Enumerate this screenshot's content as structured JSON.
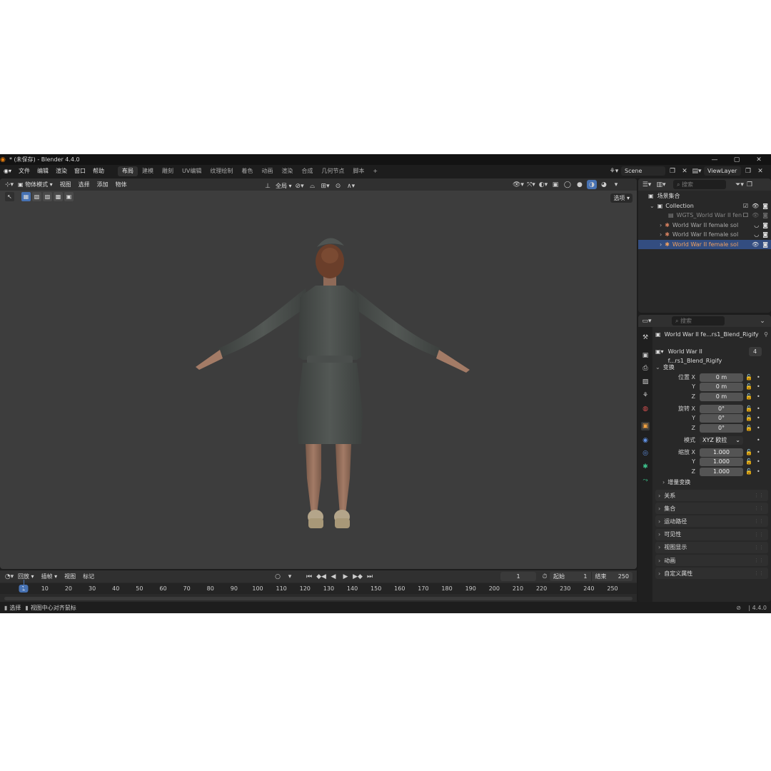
{
  "titlebar": {
    "title": "* (未保存) - Blender 4.4.0"
  },
  "menubar": {
    "items": [
      "文件",
      "编辑",
      "渲染",
      "窗口",
      "帮助"
    ],
    "workspaces": [
      "布局",
      "建模",
      "雕刻",
      "UV编辑",
      "纹理绘制",
      "着色",
      "动画",
      "渲染",
      "合成",
      "几何节点",
      "脚本"
    ],
    "active_workspace": "布局",
    "add_tab": "+",
    "scene": "Scene",
    "view_layer": "ViewLayer"
  },
  "viewport": {
    "mode": "物体模式",
    "menus": [
      "视图",
      "选择",
      "添加",
      "物体"
    ],
    "orientation": "全局",
    "options": "选项"
  },
  "timeline": {
    "playback": "回放",
    "keying": "插帧",
    "view": "视图",
    "marker": "标记",
    "current_frame": "1",
    "start_label": "起始",
    "start": "1",
    "end_label": "结束",
    "end": "250",
    "ticks": [
      1,
      10,
      20,
      30,
      40,
      50,
      60,
      70,
      80,
      90,
      100,
      110,
      120,
      130,
      140,
      150,
      160,
      170,
      180,
      190,
      200,
      210,
      220,
      230,
      240,
      250
    ]
  },
  "status": {
    "select": "选择",
    "center": "视图中心对齐鼠标",
    "version": "4.4.0"
  },
  "outliner": {
    "search_placeholder": "搜索",
    "root": "场景集合",
    "collection": "Collection",
    "items": [
      {
        "name": "WGTS_World War II fen",
        "selected": false
      },
      {
        "name": "World War II female sol",
        "selected": false
      },
      {
        "name": "World War II female sol",
        "selected": false
      },
      {
        "name": "World War II female sol",
        "selected": true
      }
    ]
  },
  "properties": {
    "search_placeholder": "搜索",
    "object_name": "World War II fe...rs1_Blend_Rigify",
    "data_name": "World War II f...rs1_Blend_Rigify",
    "users": "4",
    "transform": "变换",
    "location_label": "位置 X",
    "rotation_label": "旋转 X",
    "scale_label": "缩放 X",
    "y": "Y",
    "z": "Z",
    "location": [
      "0 m",
      "0 m",
      "0 m"
    ],
    "rotation": [
      "0°",
      "0°",
      "0°"
    ],
    "mode_label": "模式",
    "mode_value": "XYZ 欧拉",
    "scale": [
      "1.000",
      "1.000",
      "1.000"
    ],
    "delta": "增量变换",
    "sections": [
      "关系",
      "集合",
      "运动路径",
      "可见性",
      "视图显示",
      "动画",
      "自定义属性"
    ]
  }
}
